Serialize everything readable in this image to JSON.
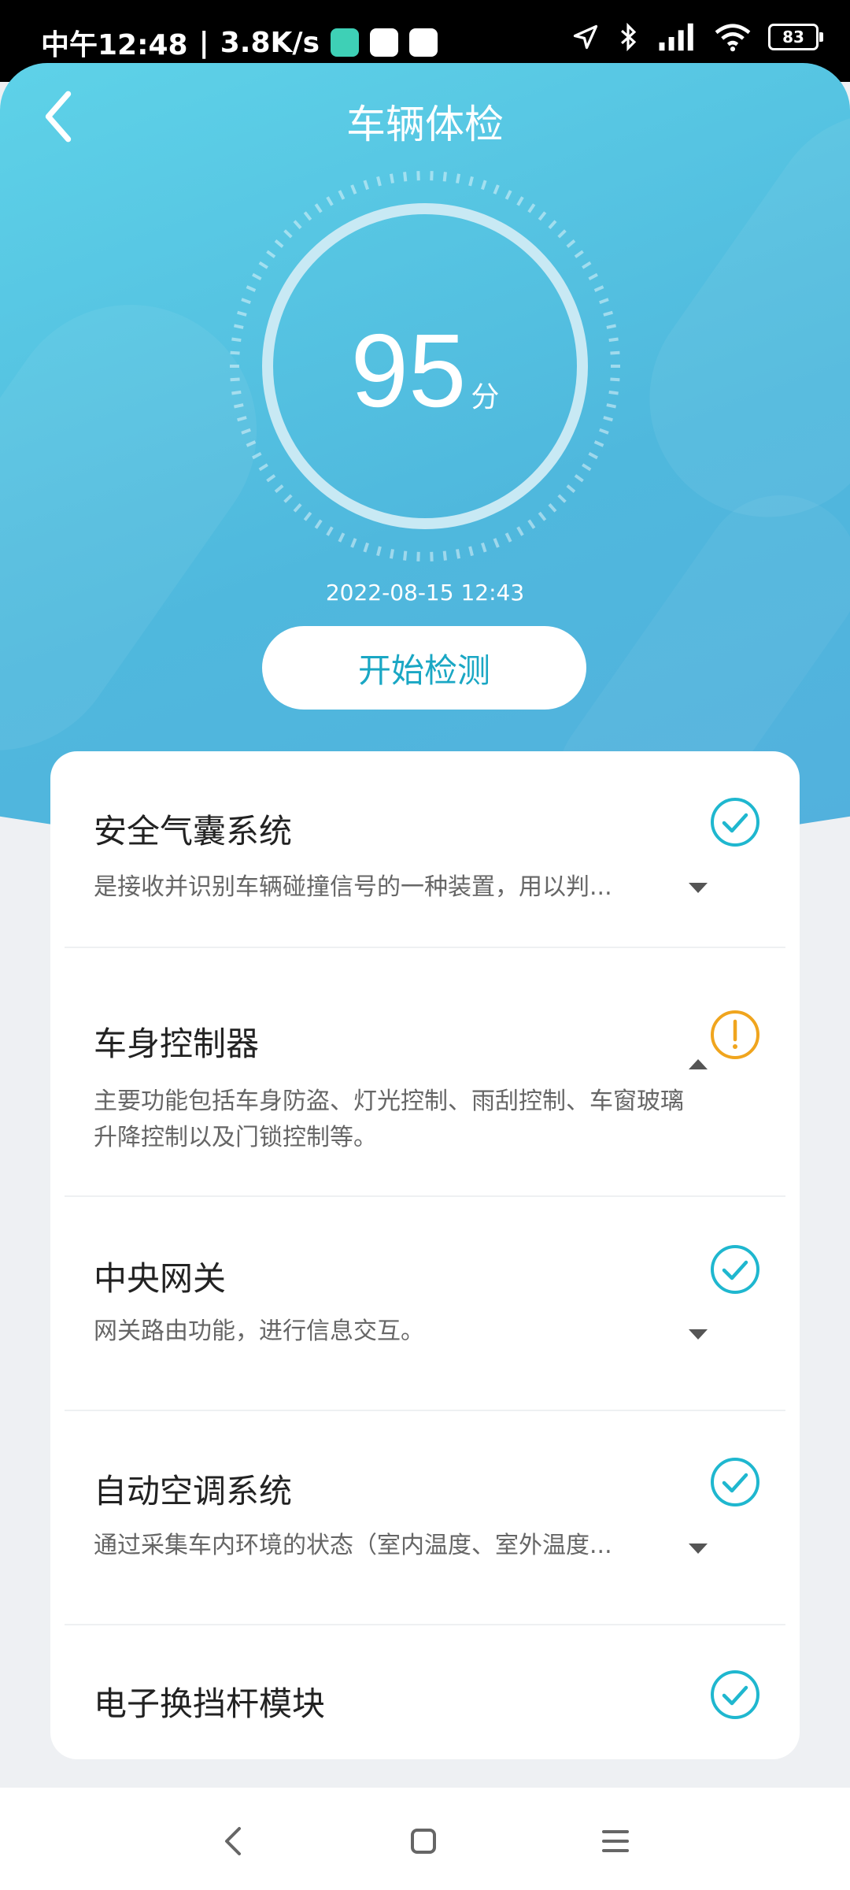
{
  "status_bar": {
    "time": "中午12:48",
    "speed": "3.8K/s",
    "battery": "83"
  },
  "header": {
    "title": "车辆体检",
    "score": "95",
    "score_unit": "分",
    "check_time": "2022-08-15 12:43",
    "start_button": "开始检测"
  },
  "items": [
    {
      "title": "安全气囊系统",
      "desc": "是接收并识别车辆碰撞信号的一种装置，用以判...",
      "status": "ok",
      "expanded": false
    },
    {
      "title": "车身控制器",
      "desc": "主要功能包括车身防盗、灯光控制、雨刮控制、车窗玻璃升降控制以及门锁控制等。",
      "status": "warning",
      "expanded": true
    },
    {
      "title": "中央网关",
      "desc": "网关路由功能，进行信息交互。",
      "status": "ok",
      "expanded": false
    },
    {
      "title": "自动空调系统",
      "desc": "通过采集车内环境的状态（室内温度、室外温度...",
      "status": "ok",
      "expanded": false
    },
    {
      "title": "电子换挡杆模块",
      "desc": "",
      "status": "ok",
      "expanded": false
    }
  ],
  "colors": {
    "accent": "#1aa7c4",
    "ok": "#1fb7cf",
    "warning": "#f0a51e",
    "hero_start": "#5ed2e8",
    "hero_end": "#53b0dd"
  }
}
